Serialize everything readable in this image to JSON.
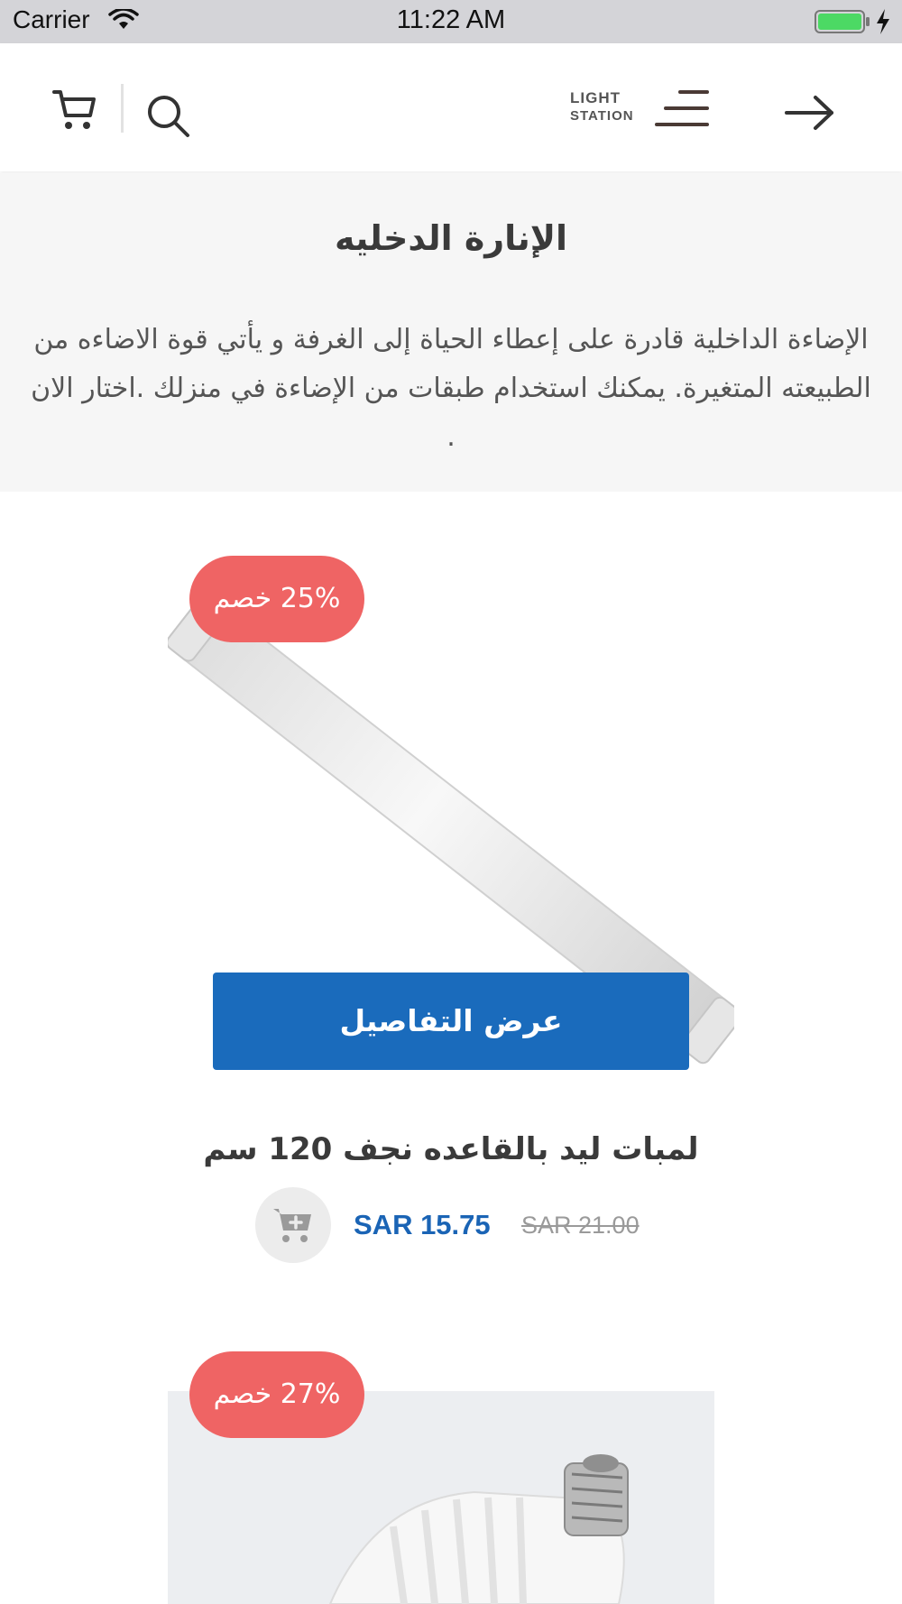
{
  "status_bar": {
    "carrier": "Carrier",
    "time": "11:22 AM"
  },
  "header": {
    "logo_line1": "LIGHT",
    "logo_line2": "STATION",
    "icons": [
      "cart-icon",
      "search-icon",
      "menu-icon",
      "arrow-right-icon"
    ]
  },
  "category": {
    "title": "الإنارة الدخليه",
    "description": "الإضاءة الداخلية قادرة على إعطاء الحياة إلى الغرفة و يأتي قوة الاضاءه من الطبيعته المتغيرة. يمكنك استخدام طبقات من الإضاءة في منزلك .اختار الان ."
  },
  "products": [
    {
      "discount": "25% خصم",
      "details_label": "عرض التفاصيل",
      "name": "لمبات ليد بالقاعده نجف 120 سم",
      "price_new": "SAR 15.75",
      "price_old": "SAR 21.00"
    },
    {
      "discount": "27% خصم"
    }
  ],
  "colors": {
    "accent": "#1a6bbc",
    "badge": "#ef6464",
    "price": "#1a64b5"
  }
}
